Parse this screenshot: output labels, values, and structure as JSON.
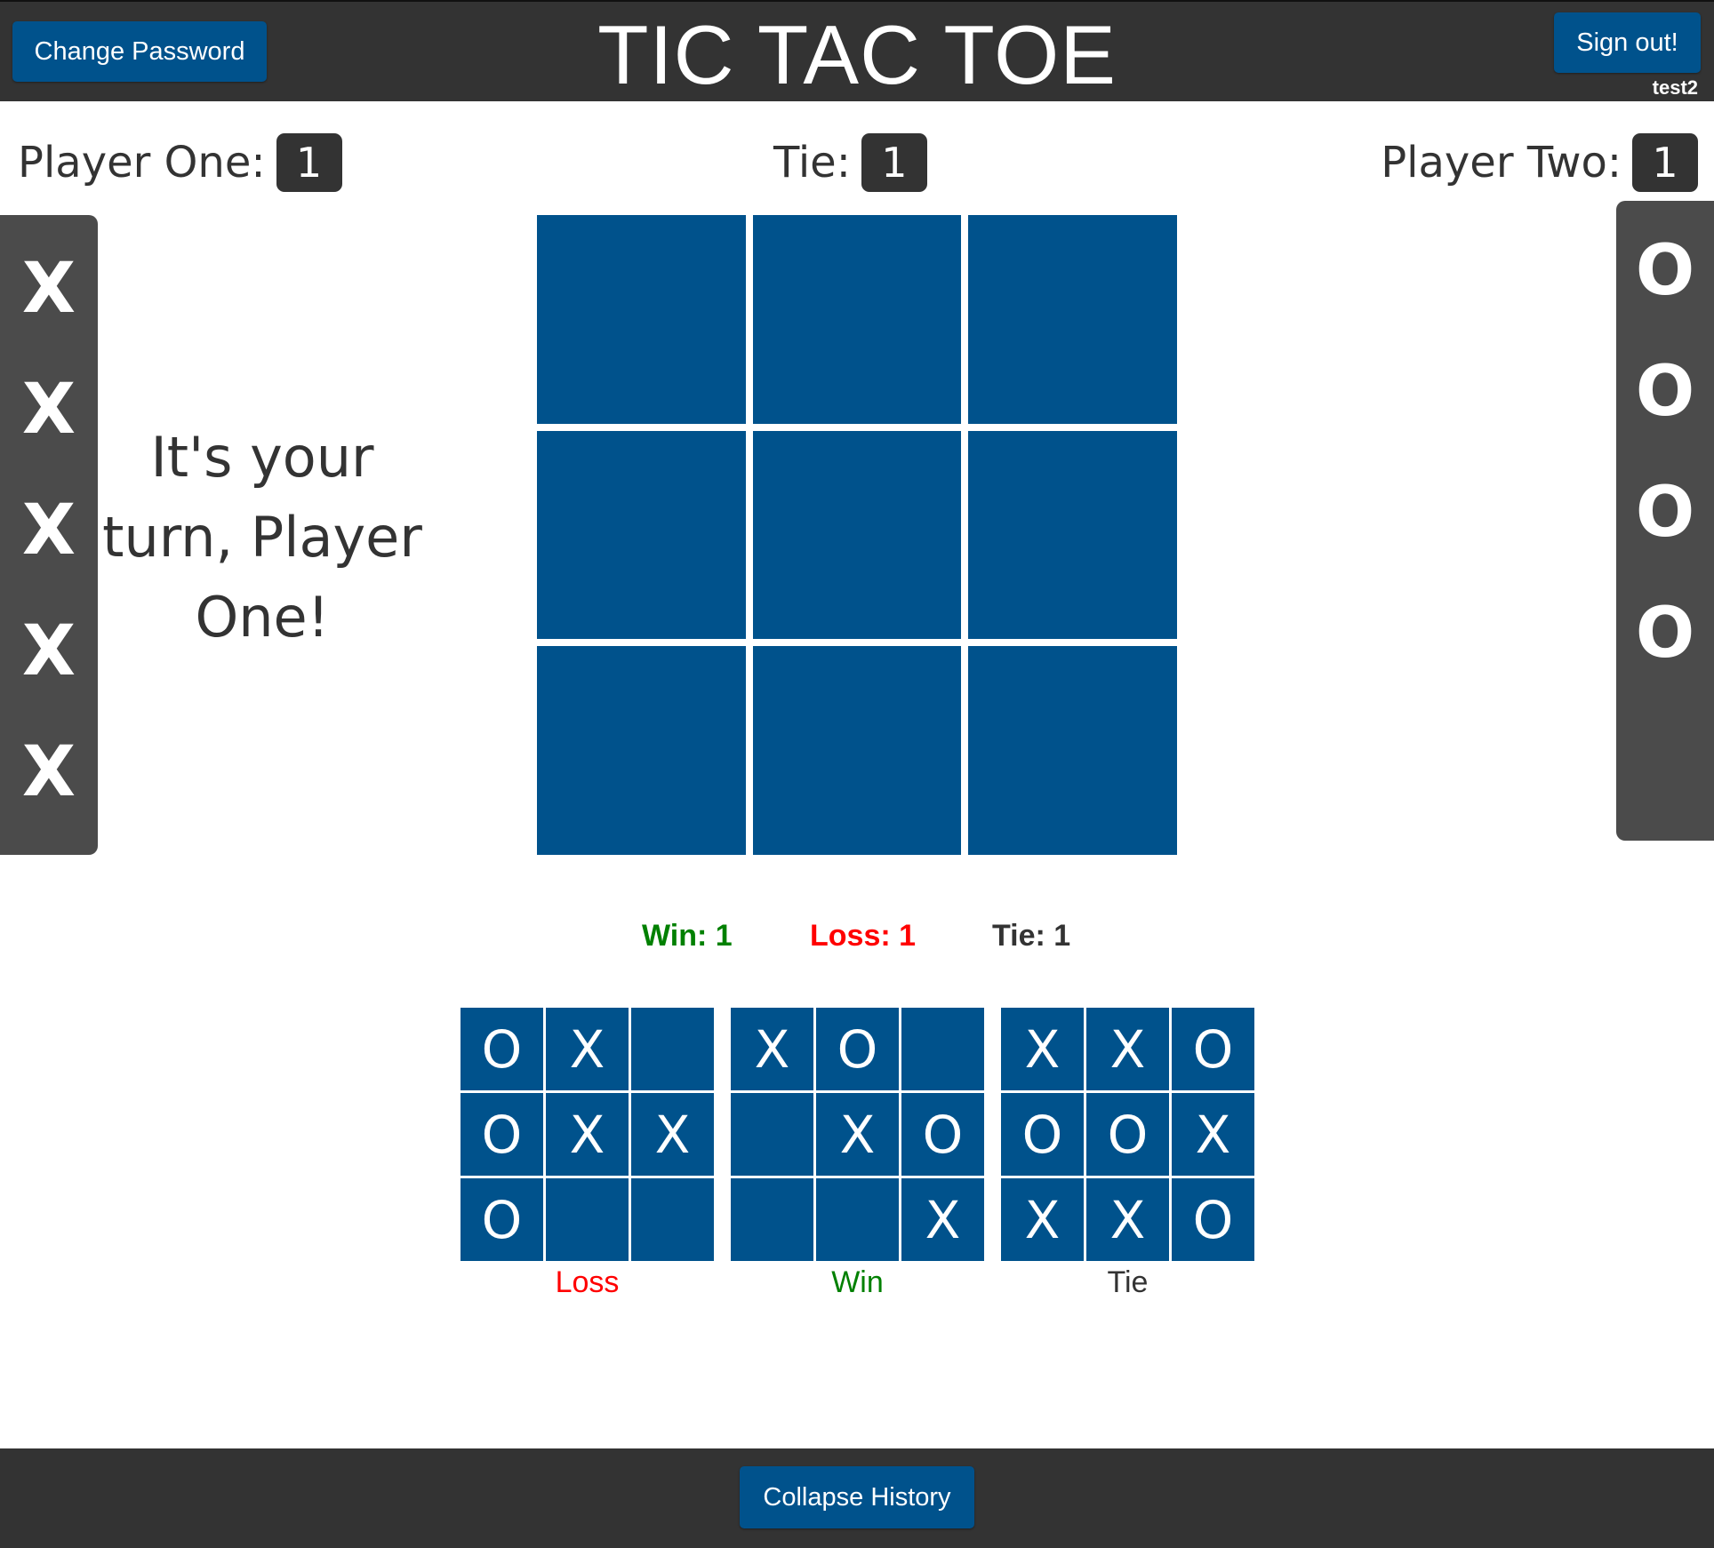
{
  "header": {
    "title": "TIC TAC TOE",
    "change_password_label": "Change Password",
    "sign_out_label": "Sign out!",
    "username": "test2"
  },
  "scoreboard": {
    "player_one_label": "Player One:",
    "player_one_score": "1",
    "tie_label": "Tie:",
    "tie_score": "1",
    "player_two_label": "Player Two:",
    "player_two_score": "1"
  },
  "trays": {
    "x_pieces": [
      "X",
      "X",
      "X",
      "X",
      "X"
    ],
    "o_pieces": [
      "O",
      "O",
      "O",
      "O"
    ]
  },
  "turn_message": "It's your turn, Player One!",
  "board": [
    "",
    "",
    "",
    "",
    "",
    "",
    "",
    "",
    ""
  ],
  "history_stats": {
    "win": "Win: 1",
    "loss": "Loss: 1",
    "tie": "Tie: 1"
  },
  "history_games": [
    {
      "result": "Loss",
      "cells": [
        "O",
        "X",
        "",
        "O",
        "X",
        "X",
        "O",
        "",
        ""
      ]
    },
    {
      "result": "Win",
      "cells": [
        "X",
        "O",
        "",
        "",
        "X",
        "O",
        "",
        "",
        "X"
      ]
    },
    {
      "result": "Tie",
      "cells": [
        "X",
        "X",
        "O",
        "O",
        "O",
        "X",
        "X",
        "X",
        "O"
      ]
    }
  ],
  "footer": {
    "collapse_label": "Collapse History"
  },
  "colors": {
    "bar": "#333333",
    "board_blue": "#00528c",
    "win": "#008000",
    "loss": "#ff0000",
    "tie": "#333333",
    "tray": "#4b4b4b"
  }
}
